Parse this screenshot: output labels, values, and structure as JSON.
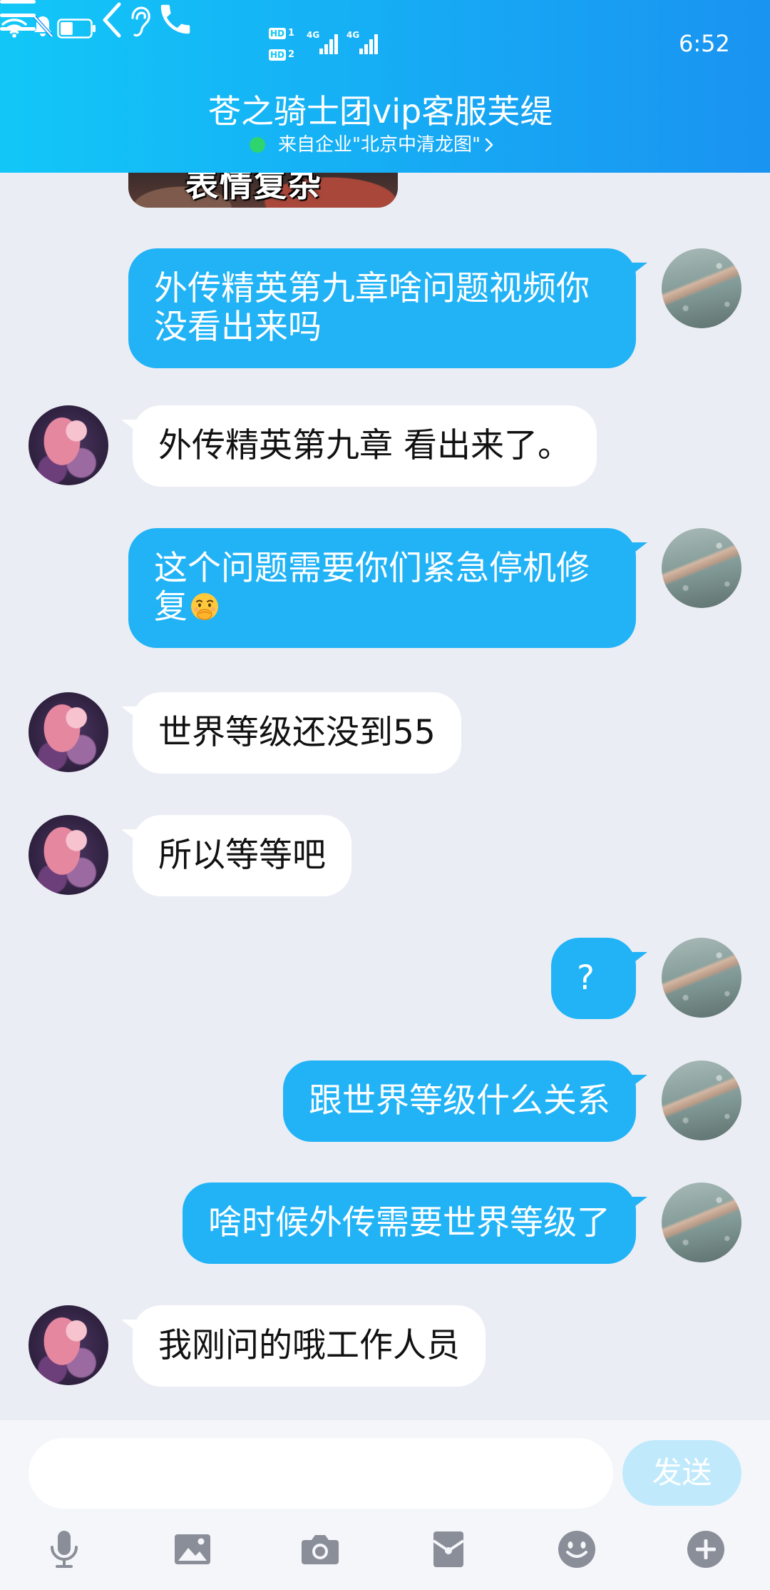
{
  "colors": {
    "header_start": "#12C7F8",
    "header_end": "#1A93F1",
    "chat_bg": "#EBEDF5",
    "composer_bg": "#F5F6FA",
    "self_bubble": "#21B3F6",
    "other_bubble": "#FFFFFF",
    "send_button": "#C0EAFC",
    "icon_grey": "#8A8E99",
    "online_dot": "#2ED46E"
  },
  "status_bar": {
    "sim_slots": [
      {
        "badge": "HD",
        "number": "1"
      },
      {
        "badge": "HD",
        "number": "2"
      }
    ],
    "networks": [
      "4G",
      "4G"
    ],
    "icons": [
      "signal-icon",
      "signal-icon",
      "wifi-icon",
      "bell-off-icon",
      "battery-icon"
    ],
    "battery_level": 0.42,
    "time": "6:52"
  },
  "header": {
    "back_icon": "chevron-left-icon",
    "title_icon": "ear-icon",
    "title": "苍之骑士团vip客服芙缇",
    "subtitle": "来自企业\"北京中清龙图\"",
    "subtitle_icon": "chevron-right-icon",
    "actions": [
      "phone-icon",
      "menu-icon"
    ]
  },
  "sticker": {
    "text": "表情复杂"
  },
  "messages": [
    {
      "from": "self",
      "text": "外传精英第九章啥问题视频你没看出来吗"
    },
    {
      "from": "other",
      "text": "外传精英第九章 看出来了。"
    },
    {
      "from": "self",
      "text": "这个问题需要你们紧急停机修复",
      "emoji": "covering-mouth-emoji-icon"
    },
    {
      "from": "other",
      "text": "世界等级还没到55"
    },
    {
      "from": "other",
      "text": "所以等等吧"
    },
    {
      "from": "self",
      "text": "?"
    },
    {
      "from": "self",
      "text": "跟世界等级什么关系"
    },
    {
      "from": "self",
      "text": "啥时候外传需要世界等级了"
    },
    {
      "from": "other",
      "text": "我刚问的哦工作人员"
    }
  ],
  "composer": {
    "input_value": "",
    "send_label": "发送"
  },
  "toolbar": {
    "icons": [
      "microphone-icon",
      "image-icon",
      "camera-icon",
      "red-packet-icon",
      "emoji-icon",
      "plus-icon"
    ]
  }
}
